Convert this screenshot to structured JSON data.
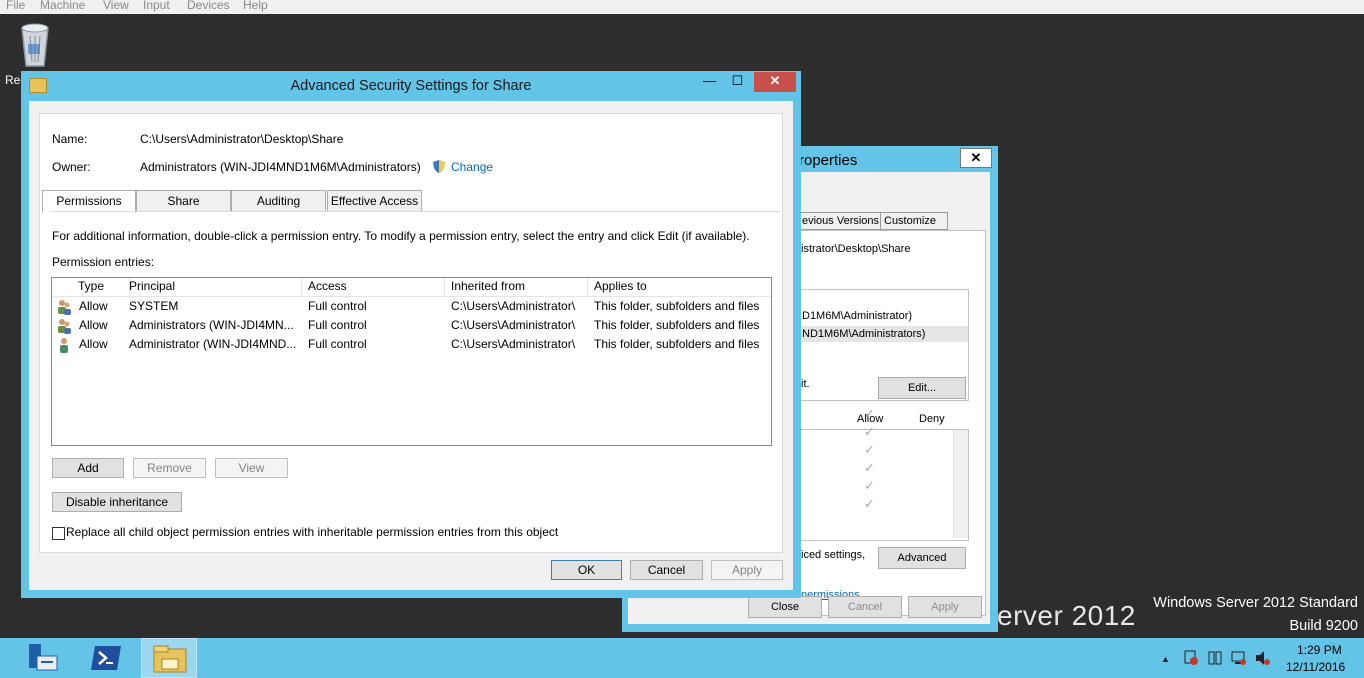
{
  "vm_menu": [
    "File",
    "Machine",
    "View",
    "Input",
    "Devices",
    "Help"
  ],
  "desktop": {
    "recycle_label": "Rec",
    "watermark_brand": "erver 2012",
    "watermark_edition": "Windows Server 2012 Standard",
    "watermark_build": "Build 9200"
  },
  "props_window": {
    "title": "roperties",
    "close": "✕",
    "tabs": [
      "evious Versions",
      "Customize"
    ],
    "path": "istrator\\Desktop\\Share",
    "users": [
      "D1M6M\\Administrator)",
      "ND1M6M\\Administrators)"
    ],
    "edit_hint": "it.",
    "edit_button": "Edit...",
    "col_allow": "Allow",
    "col_deny": "Deny",
    "tick": "✓",
    "advanced_hint": "iced settings,",
    "advanced_button": "Advanced",
    "perm_link": "permissions",
    "close_button": "Close",
    "cancel_button": "Cancel",
    "apply_button": "Apply"
  },
  "dialog": {
    "title": "Advanced Security Settings for Share",
    "min": "—",
    "max": "☐",
    "close": "✕",
    "name_label": "Name:",
    "name_value": "C:\\Users\\Administrator\\Desktop\\Share",
    "owner_label": "Owner:",
    "owner_value": "Administrators (WIN-JDI4MND1M6M\\Administrators)",
    "change_link": "Change",
    "tabs": [
      "Permissions",
      "Share",
      "Auditing",
      "Effective Access"
    ],
    "info_text": "For additional information, double-click a permission entry. To modify a permission entry, select the entry and click Edit (if available).",
    "entries_label": "Permission entries:",
    "columns": [
      "Type",
      "Principal",
      "Access",
      "Inherited from",
      "Applies to"
    ],
    "rows": [
      {
        "type": "Allow",
        "principal": "SYSTEM",
        "access": "Full control",
        "inherited": "C:\\Users\\Administrator\\",
        "applies": "This folder, subfolders and files"
      },
      {
        "type": "Allow",
        "principal": "Administrators (WIN-JDI4MN...",
        "access": "Full control",
        "inherited": "C:\\Users\\Administrator\\",
        "applies": "This folder, subfolders and files"
      },
      {
        "type": "Allow",
        "principal": "Administrator (WIN-JDI4MND...",
        "access": "Full control",
        "inherited": "C:\\Users\\Administrator\\",
        "applies": "This folder, subfolders and files"
      }
    ],
    "add_button": "Add",
    "remove_button": "Remove",
    "view_button": "View",
    "disable_inheritance_button": "Disable inheritance",
    "replace_checkbox_label": "Replace all child object permission entries with inheritable permission entries from this object",
    "ok_button": "OK",
    "cancel_button": "Cancel",
    "apply_button": "Apply"
  },
  "taskbar": {
    "time": "1:29 PM",
    "date": "12/11/2016",
    "tray_arrow": "▲"
  },
  "colors": {
    "accent": "#63c4e8",
    "desktop": "#2d2d2d",
    "close_red": "#c7504b",
    "link": "#0066cc"
  }
}
